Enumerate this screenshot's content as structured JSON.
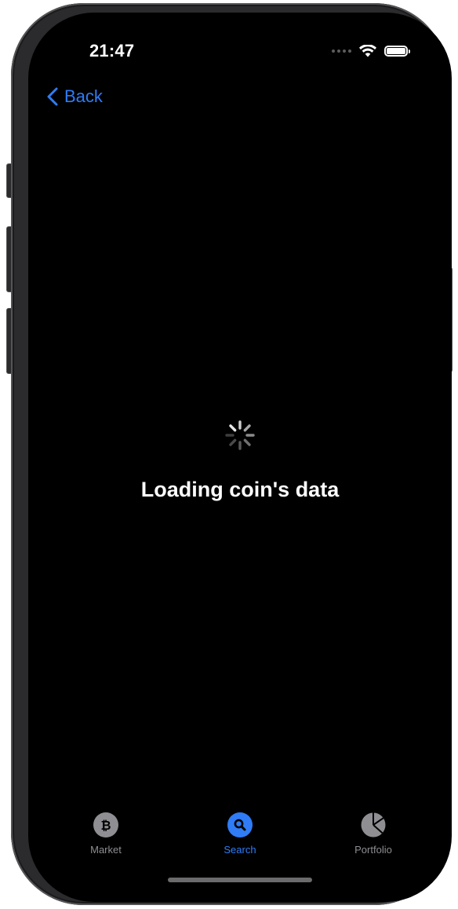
{
  "status_bar": {
    "time": "21:47",
    "signal_icon": "signal-dots-icon",
    "wifi_icon": "wifi-icon",
    "battery_icon": "battery-icon"
  },
  "nav": {
    "back_label": "Back",
    "back_icon": "chevron-left-icon"
  },
  "content": {
    "loading_text": "Loading coin's data",
    "spinner_icon": "activity-spinner-icon"
  },
  "tabbar": {
    "tabs": [
      {
        "label": "Market",
        "icon": "bitcoin-icon",
        "active": false
      },
      {
        "label": "Search",
        "icon": "search-icon",
        "active": true
      },
      {
        "label": "Portfolio",
        "icon": "pie-chart-icon",
        "active": false
      }
    ]
  },
  "colors": {
    "accent": "#2f7cf6",
    "inactive": "#8e8e93",
    "background": "#000000"
  }
}
